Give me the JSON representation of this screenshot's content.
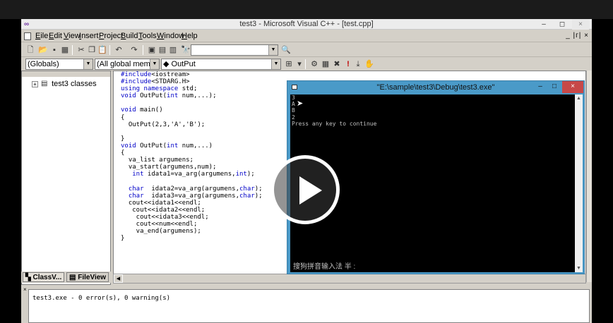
{
  "app": {
    "title": "test3 - Microsoft Visual C++ - [test.cpp]",
    "window_controls": {
      "minimize": "–",
      "maximize": "◻",
      "close": "×"
    },
    "mdi_controls": "_ |ᴦ| ×"
  },
  "menu": [
    {
      "key": "E",
      "rest": "ile"
    },
    {
      "key": "E",
      "rest": "dit"
    },
    {
      "key": "V",
      "rest": "iew"
    },
    {
      "key": "I",
      "rest": "nsert"
    },
    {
      "key": "P",
      "rest": "roject"
    },
    {
      "key": "B",
      "rest": "uild"
    },
    {
      "key": "T",
      "rest": "ools"
    },
    {
      "key": "W",
      "rest": "indow"
    },
    {
      "key": "H",
      "rest": "elp"
    }
  ],
  "toolbar": {
    "combo_find": "",
    "scope_combo": "(Globals)",
    "members_combo": "(All global members",
    "function_combo": "◆ OutPut"
  },
  "workspace": {
    "tree_root": "test3 classes",
    "tabs": {
      "classview": "ClassV...",
      "fileview": "FileView"
    }
  },
  "editor": {
    "lines": [
      [
        {
          "t": "#include<iostream>"
        }
      ],
      [
        {
          "t": "#include<STDARG.H>"
        }
      ],
      [
        {
          "t": "using namespace std;"
        }
      ],
      [
        {
          "t": "void OutPut(int num,...);"
        }
      ],
      [
        {
          "t": ""
        }
      ],
      [
        {
          "t": "void main()"
        }
      ],
      [
        {
          "t": "{"
        }
      ],
      [
        {
          "t": "  OutPut(2,3,'A','B');"
        }
      ],
      [
        {
          "t": ""
        }
      ],
      [
        {
          "t": "}"
        }
      ],
      [
        {
          "t": "void OutPut(int num,...)"
        }
      ],
      [
        {
          "t": "{"
        }
      ],
      [
        {
          "t": "  va_list argumens;"
        }
      ],
      [
        {
          "t": "  va_start(argumens,num);"
        }
      ],
      [
        {
          "t": "   int idata1=va_arg(argumens,int);"
        }
      ],
      [
        {
          "t": ""
        }
      ],
      [
        {
          "t": "  char  idata2=va_arg(argumens,char);"
        }
      ],
      [
        {
          "t": "  char  idata3=va_arg(argumens,char);"
        }
      ],
      [
        {
          "t": "  cout<<idata1<<endl;"
        }
      ],
      [
        {
          "t": "   cout<<idata2<<endl;"
        }
      ],
      [
        {
          "t": "    cout<<idata3<<endl;"
        }
      ],
      [
        {
          "t": "    cout<<num<<endl;"
        }
      ],
      [
        {
          "t": "    va_end(argumens);"
        }
      ],
      [
        {
          "t": "}"
        }
      ]
    ]
  },
  "console": {
    "title": "\"E:\\sample\\test3\\Debug\\test3.exe\"",
    "lines": [
      "3",
      "A",
      "B",
      "2",
      "Press any key to continue"
    ],
    "ime_status": "搜狗拼音输入法 半 :",
    "controls": {
      "minimize": "–",
      "maximize": "□",
      "close": "×"
    }
  },
  "output": {
    "text": "test3.exe - 0 error(s), 0 warning(s)"
  },
  "icons": {
    "accent": "#4a9ac8",
    "close_red": "#c74848",
    "keyword_blue": "#0000c8"
  }
}
